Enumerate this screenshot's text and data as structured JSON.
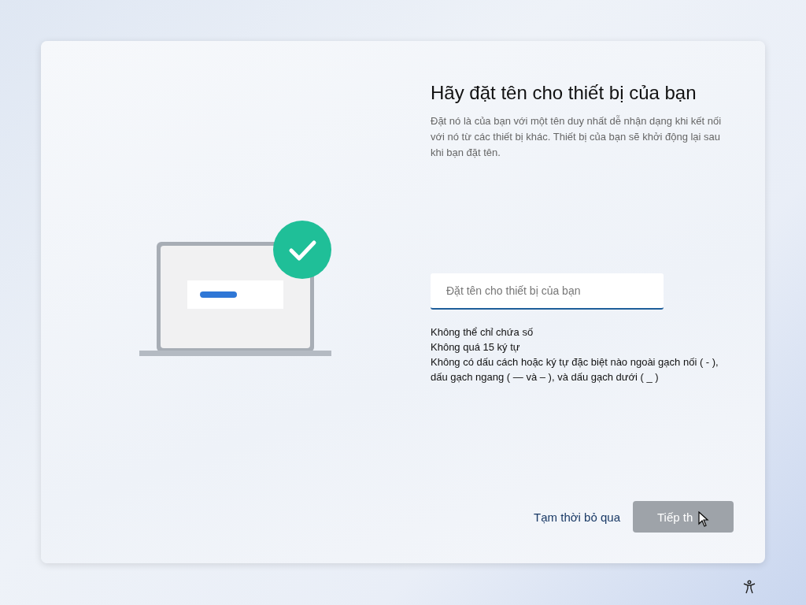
{
  "title": "Hãy đặt tên cho thiết bị của bạn",
  "description": "Đặt nó là của bạn với một tên duy nhất dễ nhận dạng khi kết nối với nó từ các thiết bị khác. Thiết bị của bạn sẽ khởi động lại sau khi bạn đặt tên.",
  "name_field": {
    "placeholder": "Đặt tên cho thiết bị của bạn",
    "focused": true
  },
  "rules": [
    "Không thể chỉ chứa số",
    "Không quá 15 ký tự",
    "Không có dấu cách hoặc ký tự đặc biệt nào ngoài gạch nối ( - ), dấu gạch ngang ( — và – ), và dấu gạch dưới ( _ )"
  ],
  "buttons": [
    {
      "label": "Tạm thời bỏ qua",
      "kind": "link",
      "disabled": false
    },
    {
      "label": "Tiếp th",
      "kind": "primary",
      "disabled": true
    }
  ]
}
